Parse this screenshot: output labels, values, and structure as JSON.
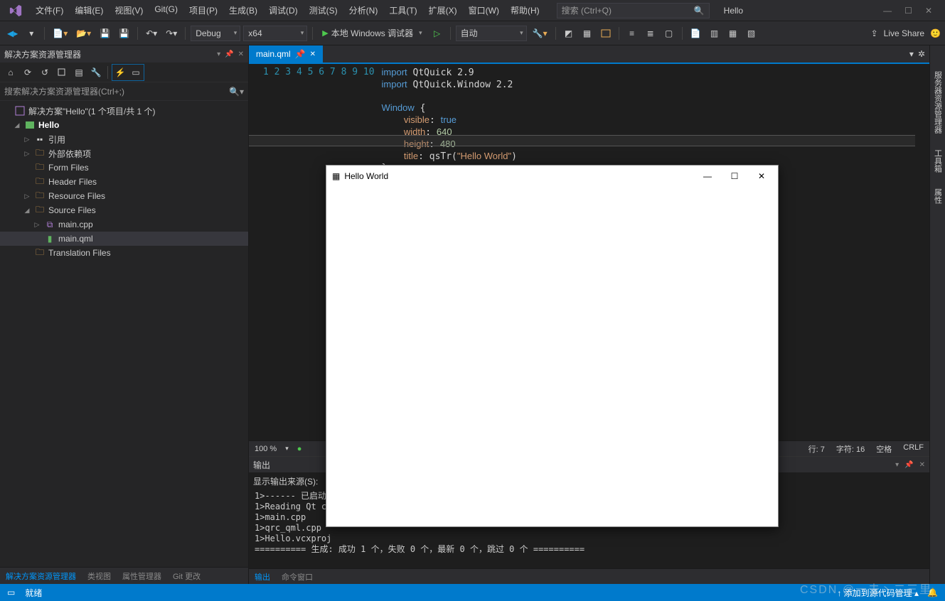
{
  "menubar": {
    "items": [
      "文件(F)",
      "编辑(E)",
      "视图(V)",
      "Git(G)",
      "项目(P)",
      "生成(B)",
      "调试(D)",
      "测试(S)",
      "分析(N)",
      "工具(T)",
      "扩展(X)",
      "窗口(W)",
      "帮助(H)"
    ],
    "search_placeholder": "搜索 (Ctrl+Q)",
    "solution_tag": "Hello"
  },
  "toolbar": {
    "config": "Debug",
    "platform": "x64",
    "run_label": "本地 Windows 调试器",
    "auto_label": "自动",
    "live_share": "Live Share"
  },
  "solution_explorer": {
    "title": "解决方案资源管理器",
    "search_placeholder": "搜索解决方案资源管理器(Ctrl+;)",
    "root": "解决方案\"Hello\"(1 个项目/共 1 个)",
    "project": "Hello",
    "nodes": {
      "references": "引用",
      "external_deps": "外部依赖项",
      "form_files": "Form Files",
      "header_files": "Header Files",
      "resource_files": "Resource Files",
      "source_files": "Source Files",
      "main_cpp": "main.cpp",
      "main_qml": "main.qml",
      "translation_files": "Translation Files"
    },
    "bottom_tabs": [
      "解决方案资源管理器",
      "类视图",
      "属性管理器",
      "Git 更改"
    ]
  },
  "editor": {
    "tab_name": "main.qml",
    "code_lines": [
      {
        "n": 1,
        "html": "<span class='kw'>import</span> QtQuick 2.9"
      },
      {
        "n": 2,
        "html": "<span class='kw'>import</span> QtQuick.Window 2.2"
      },
      {
        "n": 3,
        "html": ""
      },
      {
        "n": 4,
        "html": "<span class='kw'>Window</span> {"
      },
      {
        "n": 5,
        "html": "    <span class='prop'>visible</span>: <span class='kw'>true</span>"
      },
      {
        "n": 6,
        "html": "    <span class='prop'>width</span>: <span class='num'>640</span>"
      },
      {
        "n": 7,
        "html": "    <span class='prop'>height</span>: <span class='num'>480</span>"
      },
      {
        "n": 8,
        "html": "    <span class='prop'>title</span>: qsTr(<span class='str'>\"Hello World\"</span>)"
      },
      {
        "n": 9,
        "html": "}"
      },
      {
        "n": 10,
        "html": ""
      }
    ],
    "status": {
      "zoom": "100 %",
      "line": "行: 7",
      "col": "字符: 16",
      "ins": "空格",
      "eol": "CRLF"
    }
  },
  "output": {
    "title": "输出",
    "source_label": "显示输出来源(S):",
    "lines": [
      "1>------ 已启动",
      "1>Reading Qt c",
      "1>main.cpp",
      "1>qrc_qml.cpp",
      "1>Hello.vcxproj",
      "========== 生成: 成功 1 个，失败 0 个，最新 0 个，跳过 0 个 =========="
    ],
    "tabs": [
      "输出",
      "命令窗口"
    ]
  },
  "right_rail": [
    "服务器资源管理器",
    "工具箱",
    "属性"
  ],
  "statusbar": {
    "ready": "就绪",
    "add_src": "↑ 添加到源代码管理 ▴"
  },
  "hello_window": {
    "title": "Hello World"
  },
  "watermark": "CSDN @一去丶二三里"
}
